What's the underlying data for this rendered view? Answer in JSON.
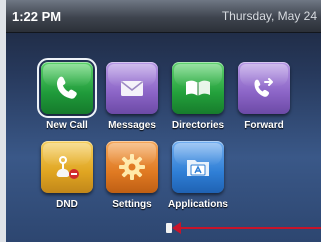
{
  "status_bar": {
    "time": "1:22 PM",
    "date": "Thursday, May 24"
  },
  "apps": [
    {
      "label": "New Call",
      "icon": "phone-handset-icon",
      "color": "#1f9a3a",
      "selected": true
    },
    {
      "label": "Messages",
      "icon": "envelope-icon",
      "color": "#8b64c6",
      "selected": false
    },
    {
      "label": "Directories",
      "icon": "open-book-icon",
      "color": "#23a03b",
      "selected": false
    },
    {
      "label": "Forward",
      "icon": "call-forward-icon",
      "color": "#8b64c6",
      "selected": false
    },
    {
      "label": "DND",
      "icon": "do-not-disturb-icon",
      "color": "#e0a521",
      "selected": false
    },
    {
      "label": "Settings",
      "icon": "gear-icon",
      "color": "#e07a22",
      "selected": false
    },
    {
      "label": "Applications",
      "icon": "folder-applications-icon",
      "color": "#2f7fd6",
      "selected": false
    }
  ],
  "colors": {
    "accent_red": "#c8142a"
  }
}
